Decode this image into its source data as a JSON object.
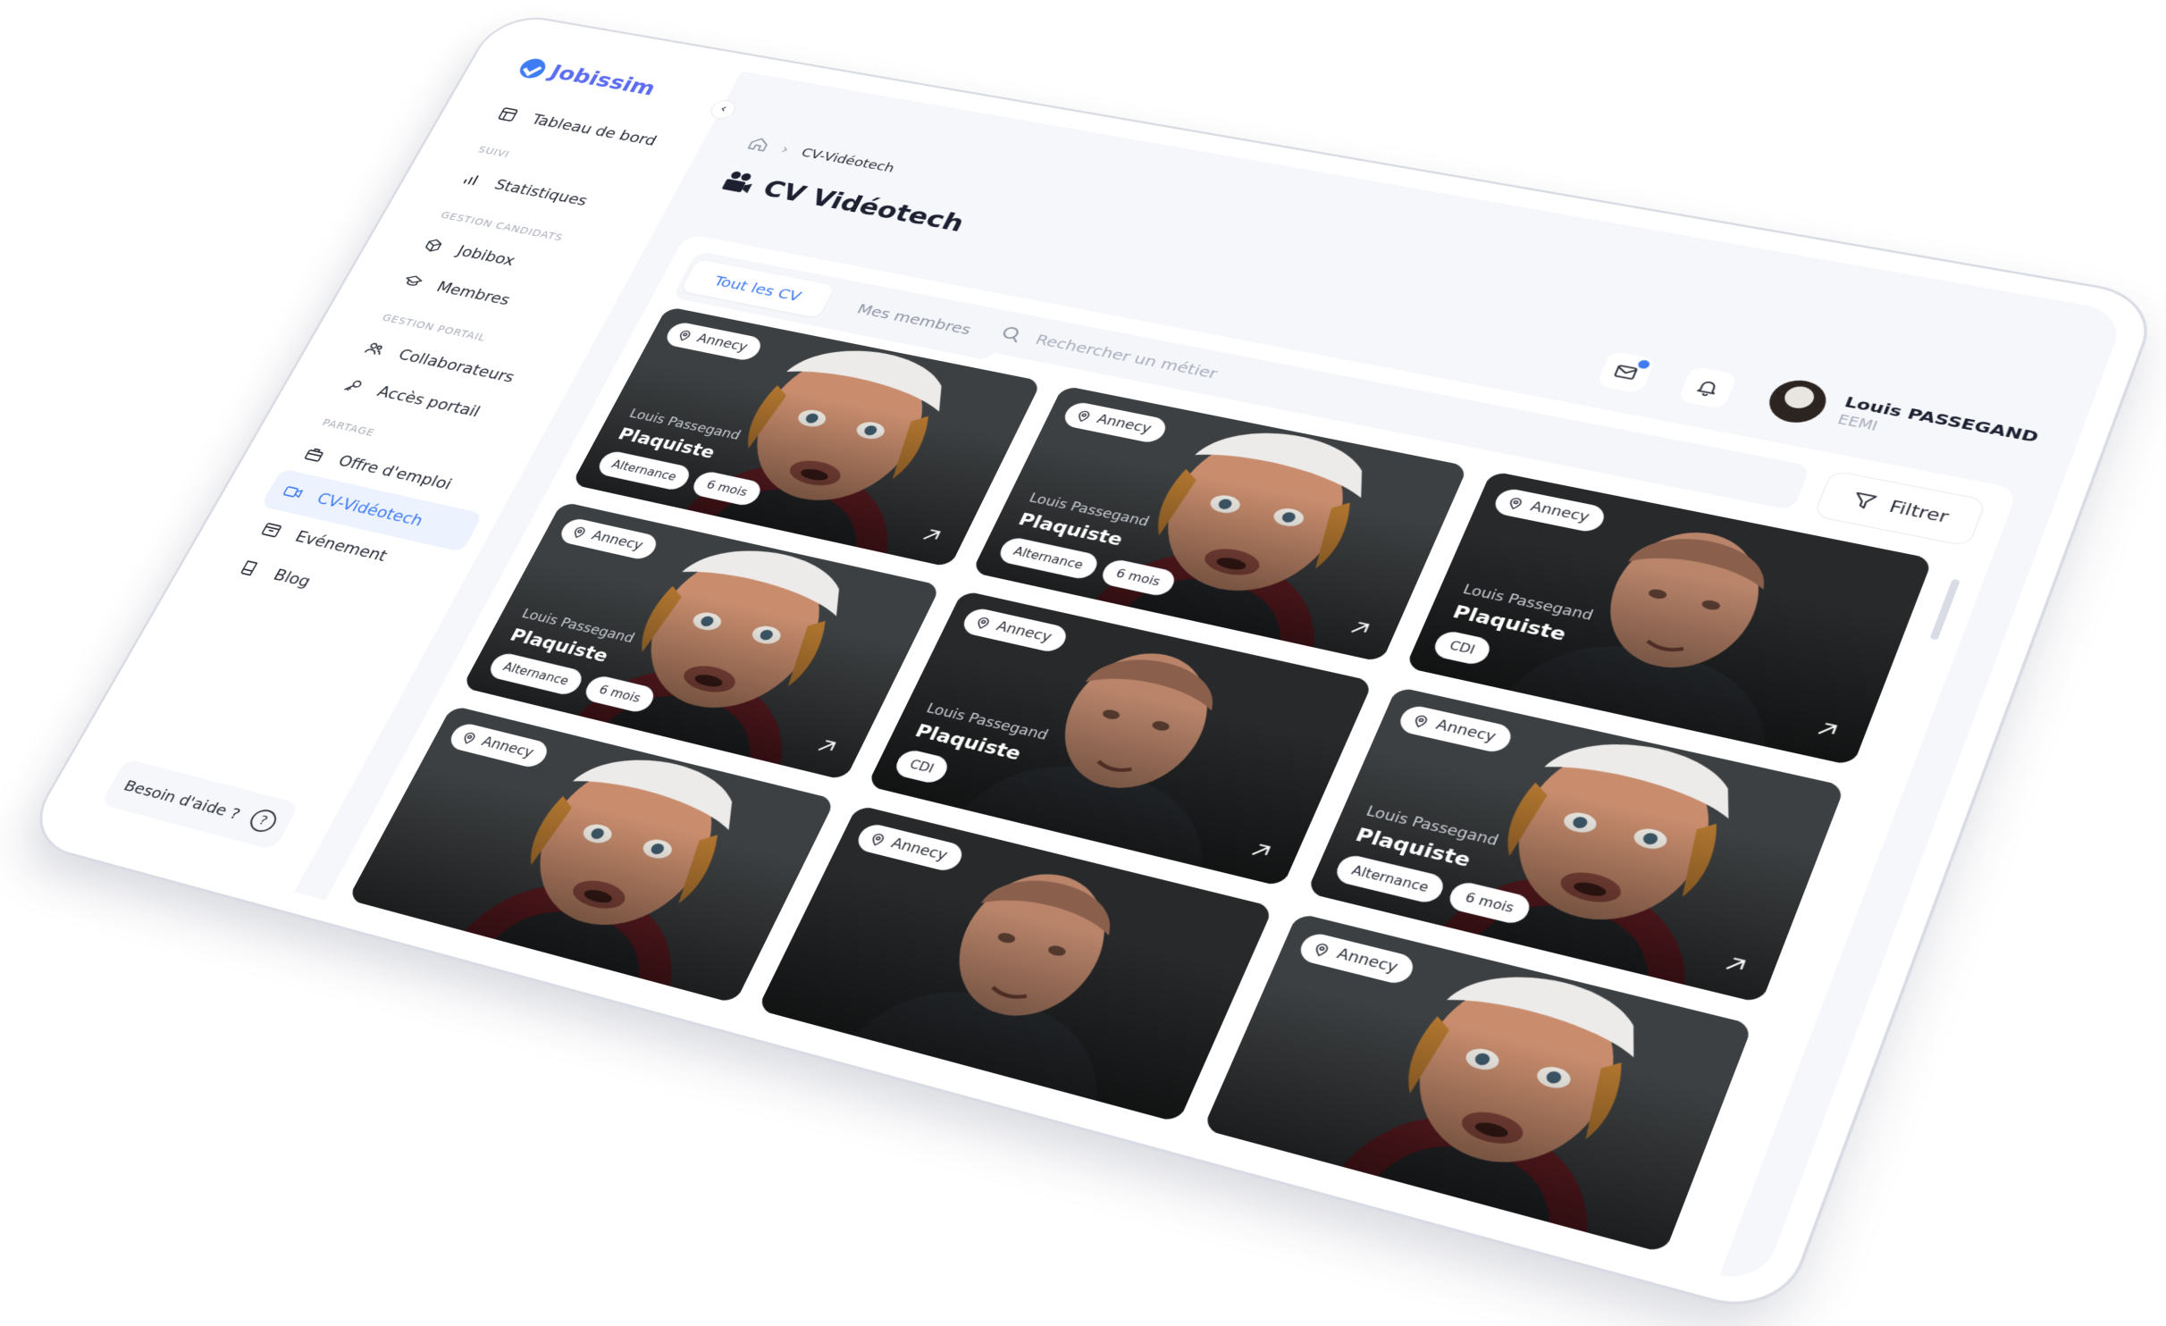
{
  "app": {
    "logo_text": "Jobissim"
  },
  "sidebar": {
    "dashboard": "Tableau de bord",
    "sections": [
      {
        "title": "SUIVI",
        "items": [
          "Statistiques"
        ]
      },
      {
        "title": "GESTION CANDIDATS",
        "items": [
          "Jobibox",
          "Membres"
        ]
      },
      {
        "title": "GESTION PORTAIL",
        "items": [
          "Collaborateurs",
          "Accès portail"
        ]
      },
      {
        "title": "PARTAGE",
        "items": [
          "Offre d'emploi",
          "CV-Vidéotech",
          "Evénement",
          "Blog"
        ]
      }
    ],
    "active_item": "CV-Vidéotech",
    "help_label": "Besoin d'aide ?"
  },
  "breadcrumb": {
    "current": "CV-Vidéotech"
  },
  "page": {
    "title": "CV Vidéotech"
  },
  "header": {
    "user_name": "Louis PASSEGAND",
    "user_org": "EEMI",
    "has_unread_mail": true
  },
  "tabs": [
    "Tout les CV",
    "Mes membres"
  ],
  "active_tab": "Tout les CV",
  "search": {
    "placeholder": "Rechercher un métier"
  },
  "filter_label": "Filtrer",
  "cards": [
    {
      "location": "Annecy",
      "candidate": "Louis Passegand",
      "job": "Plaquiste",
      "tags": [
        "Alternance",
        "6 mois"
      ],
      "photo": "young-man-cap"
    },
    {
      "location": "Annecy",
      "candidate": "Louis Passegand",
      "job": "Plaquiste",
      "tags": [
        "Alternance",
        "6 mois"
      ],
      "photo": "young-man-cap"
    },
    {
      "location": "Annecy",
      "candidate": "Louis Passegand",
      "job": "Plaquiste",
      "tags": [
        "CDI"
      ],
      "photo": "older-man"
    },
    {
      "location": "Annecy",
      "candidate": "Louis Passegand",
      "job": "Plaquiste",
      "tags": [
        "Alternance",
        "6 mois"
      ],
      "photo": "young-man-cap"
    },
    {
      "location": "Annecy",
      "candidate": "Louis Passegand",
      "job": "Plaquiste",
      "tags": [
        "CDI"
      ],
      "photo": "older-man"
    },
    {
      "location": "Annecy",
      "candidate": "Louis Passegand",
      "job": "Plaquiste",
      "tags": [
        "Alternance",
        "6 mois"
      ],
      "photo": "young-man-cap"
    },
    {
      "location": "Annecy",
      "candidate": "",
      "job": "",
      "tags": [],
      "photo": "young-man-cap"
    },
    {
      "location": "Annecy",
      "candidate": "",
      "job": "",
      "tags": [],
      "photo": "older-man"
    },
    {
      "location": "Annecy",
      "candidate": "",
      "job": "",
      "tags": [],
      "photo": "young-man-cap"
    }
  ],
  "colors": {
    "accent": "#3f7cf4",
    "logo": "#5b6cf0",
    "active_bg": "#edf3fe",
    "card_bg": "#2f3133"
  }
}
